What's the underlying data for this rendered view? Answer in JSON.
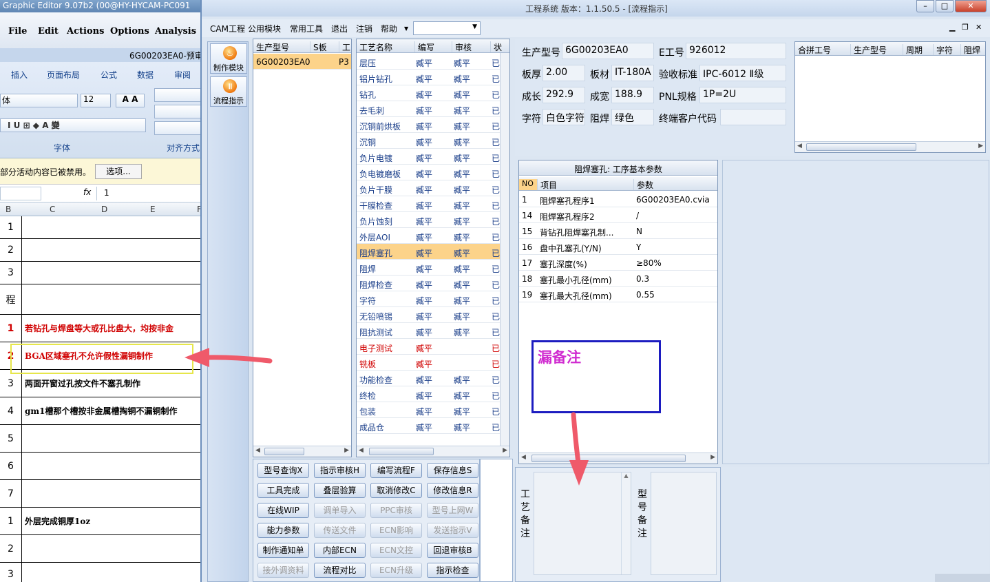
{
  "bg_window": {
    "title": "Graphic Editor 9.07b2 (00@HY-HYCAM-PC091",
    "menu": [
      "File",
      "Edit",
      "Actions",
      "Options",
      "Analysis"
    ],
    "doc_title": "6G00203EA0-预审",
    "ribbon_tabs": [
      "插入",
      "页面布局",
      "公式",
      "数据",
      "审阅"
    ],
    "font_name": "体",
    "font_size": "12",
    "group_font": "字体",
    "group_align": "对齐方式",
    "warning": "部分活动内容已被禁用。",
    "options_button": "选项...",
    "fx": "fx",
    "formula_value": "1",
    "col_headers": [
      "B",
      "C",
      "D",
      "E",
      "F"
    ],
    "rows": [
      {
        "n": "1",
        "text": ""
      },
      {
        "n": "2",
        "text": ""
      },
      {
        "n": "3",
        "text": ""
      },
      {
        "n": "程",
        "text": ""
      },
      {
        "n": "1",
        "text": "若钻孔与焊盘等大或孔比盘大，均按非金"
      },
      {
        "n": "2",
        "text": "BGA区域塞孔不允许假性漏铜制作"
      },
      {
        "n": "3",
        "text": "两面开窗过孔按文件不塞孔制作"
      },
      {
        "n": "4",
        "text": "gm1槽那个槽按非金属槽掏铜不漏铜制作"
      },
      {
        "n": "5",
        "text": ""
      },
      {
        "n": "6",
        "text": ""
      },
      {
        "n": "7",
        "text": ""
      },
      {
        "n": "1",
        "text": "外层完成铜厚1oz"
      },
      {
        "n": "2",
        "text": ""
      },
      {
        "n": "3",
        "text": ""
      }
    ]
  },
  "app": {
    "title": "工程系统  版本：1.1.50.5 - [流程指示]",
    "menu": [
      "CAM工程",
      "公用模块",
      "常用工具",
      "退出",
      "注销",
      "帮助"
    ],
    "tools": [
      "制作模块",
      "流程指示"
    ],
    "models_grid": {
      "headers": [
        "生产型号",
        "S板",
        "工"
      ],
      "rows": [
        [
          "6G00203EA0",
          "",
          "P3"
        ]
      ]
    },
    "process_grid": {
      "headers": [
        "工艺名称",
        "编写",
        "审核",
        "状"
      ],
      "rows": [
        [
          "层压",
          "臧平",
          "臧平",
          "已"
        ],
        [
          "铝片钻孔",
          "臧平",
          "臧平",
          "已"
        ],
        [
          "钻孔",
          "臧平",
          "臧平",
          "已"
        ],
        [
          "去毛刺",
          "臧平",
          "臧平",
          "已"
        ],
        [
          "沉铜前烘板",
          "臧平",
          "臧平",
          "已"
        ],
        [
          "沉铜",
          "臧平",
          "臧平",
          "已"
        ],
        [
          "负片电镀",
          "臧平",
          "臧平",
          "已"
        ],
        [
          "负电镀磨板",
          "臧平",
          "臧平",
          "已"
        ],
        [
          "负片干膜",
          "臧平",
          "臧平",
          "已"
        ],
        [
          "干膜检查",
          "臧平",
          "臧平",
          "已"
        ],
        [
          "负片蚀刻",
          "臧平",
          "臧平",
          "已"
        ],
        [
          "外层AOI",
          "臧平",
          "臧平",
          "已"
        ],
        [
          "阻焊塞孔",
          "臧平",
          "臧平",
          "已"
        ],
        [
          "阻焊",
          "臧平",
          "臧平",
          "已"
        ],
        [
          "阻焊检查",
          "臧平",
          "臧平",
          "已"
        ],
        [
          "字符",
          "臧平",
          "臧平",
          "已"
        ],
        [
          "无铅喷锡",
          "臧平",
          "臧平",
          "已"
        ],
        [
          "阻抗测试",
          "臧平",
          "臧平",
          "已"
        ],
        [
          "电子测试",
          "臧平",
          "",
          "已"
        ],
        [
          "铣板",
          "臧平",
          "",
          "已"
        ],
        [
          "功能检查",
          "臧平",
          "臧平",
          "已"
        ],
        [
          "终检",
          "臧平",
          "臧平",
          "已"
        ],
        [
          "包装",
          "臧平",
          "臧平",
          "已"
        ],
        [
          "成品仓",
          "臧平",
          "臧平",
          "已"
        ]
      ]
    },
    "info": {
      "model_label": "生产型号",
      "model": "6G00203EA0",
      "eno_label": "E工号",
      "eno": "926012",
      "thick_label": "板厚",
      "thick": "2.00",
      "mat_label": "板材",
      "mat": "IT-180A",
      "std_label": "验收标准",
      "std": "IPC-6012 Ⅱ级",
      "len_label": "成长",
      "len": "292.9",
      "wid_label": "成宽",
      "wid": "188.9",
      "pnl_label": "PNL规格",
      "pnl": "1P=2U",
      "char_label": "字符",
      "char": "白色字符",
      "sm_label": "阻焊",
      "sm": "绿色",
      "cust_label": "终端客户代码",
      "cust": ""
    },
    "merge_grid": {
      "headers": [
        "合拼工号",
        "生产型号",
        "周期",
        "字符",
        "阻焊"
      ]
    },
    "params": {
      "title": "阻焊塞孔: 工序基本参数",
      "headers": [
        "NO",
        "项目",
        "参数"
      ],
      "rows": [
        [
          "1",
          "阻焊塞孔程序1",
          "6G00203EA0.cvia"
        ],
        [
          "14",
          "阻焊塞孔程序2",
          "/"
        ],
        [
          "15",
          "背钻孔阻焊塞孔制...",
          "N"
        ],
        [
          "16",
          "盘中孔塞孔(Y/N)",
          "Y"
        ],
        [
          "17",
          "塞孔深度(%)",
          "≥80%"
        ],
        [
          "18",
          "塞孔最小孔径(mm)",
          "0.3"
        ],
        [
          "19",
          "塞孔最大孔径(mm)",
          "0.55"
        ]
      ]
    },
    "buttons": [
      [
        "型号查询X",
        "指示审核H",
        "编写流程F",
        "保存信息S"
      ],
      [
        "工具完成",
        "叠层验算",
        "取消修改C",
        "修改信息R"
      ],
      [
        "在线WIP",
        "调单导入",
        "PPC审核",
        "型号上网W"
      ],
      [
        "能力参数",
        "传送文件",
        "ECN影响",
        "发送指示V"
      ],
      [
        "制作通知单",
        "内部ECN",
        "ECN文控",
        "回退审核B"
      ],
      [
        "接外调资料",
        "流程对比",
        "ECN升级",
        "指示检查"
      ]
    ],
    "memo_craft": "工艺备注",
    "memo_model": "型号备注",
    "callout": "漏备注",
    "colors": {
      "highlight": "#fcd38a",
      "red_text": "#d00000",
      "accent": "#5f86b4"
    }
  }
}
